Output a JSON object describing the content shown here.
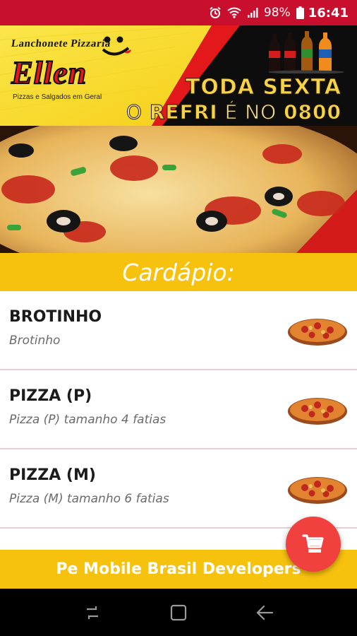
{
  "status_bar": {
    "battery": "98%",
    "time": "16:41",
    "icons": [
      "alarm-icon",
      "wifi-icon",
      "signal-icon",
      "battery-icon"
    ]
  },
  "banner": {
    "logo_top": "Lanchonete Pizzaria",
    "logo_name": "Ellen",
    "logo_sub": "Pizzas e Salgados em Geral",
    "headline_1": "TODA SEXTA",
    "headline_2_a": "O ",
    "headline_2_b": "REFRI",
    "headline_2_c": " É NO ",
    "headline_2_d": "0800"
  },
  "menu_header": "Cardápio:",
  "menu_items": [
    {
      "title": "BROTINHO",
      "description": "Brotinho",
      "icon": "pizza-thumbnail"
    },
    {
      "title": "PIZZA (P)",
      "description": "Pizza (P) tamanho 4 fatias",
      "icon": "pizza-thumbnail"
    },
    {
      "title": "PIZZA (M)",
      "description": "Pizza (M) tamanho 6 fatias",
      "icon": "pizza-thumbnail"
    },
    {
      "title": "",
      "description": "",
      "icon": "pizza-thumbnail"
    }
  ],
  "footer_text": "Pe Mobile Brasil Developers",
  "fab_icon": "cart-icon",
  "nav_icons": [
    "recent-apps-icon",
    "home-icon",
    "back-icon"
  ],
  "colors": {
    "status_bar": "#c8102e",
    "accent_yellow": "#f7c20e",
    "fab": "#f0413e"
  }
}
